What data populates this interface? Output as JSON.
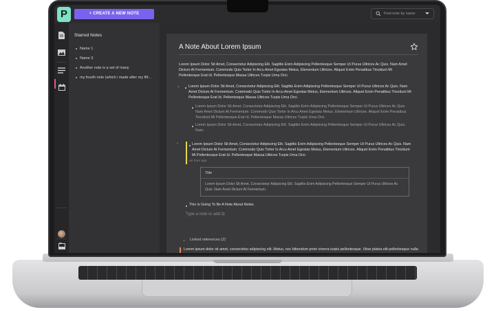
{
  "app": {
    "logo_letter": "P",
    "create_button": "+ CREATE A NEW NOTE",
    "search": {
      "placeholder": "Find note by name"
    }
  },
  "rail": {
    "icons": [
      "document-icon",
      "image-icon",
      "notes-list-icon",
      "calendar-icon"
    ],
    "active_index": 2,
    "help_label": "?"
  },
  "sidebar": {
    "title": "Starred Notes",
    "items": [
      {
        "label": "Name 1"
      },
      {
        "label": "Name 3"
      },
      {
        "label": "Another note is a set of many"
      },
      {
        "label": "my fourth note (which i made after my fift..."
      }
    ]
  },
  "note": {
    "title": "A Note About Lorem Ipsum",
    "intro": "Lorem Ipsum Dolor Sit Amet, Consectetur Adipiscing Elit. Sagittis Enim Adipiscing Pellentesque Semper Ut Purus Ultrices Ac Quis. Nam Amet Dictum At Fermentum. Commodo Quis Tortor In Arcu Amet Egestas Metus, Elementum Ultrices. Aliquet Enim Penatibus Tincidunt Mi Pellentesque Erat Id. Pellentesque Massa Ultrices Turpis Urna Orci.",
    "block1": "Lorem Ipsum Dolor Sit Amet, Consectetur Adipiscing Elit. Sagittis Enim Adipiscing Pellentesque Semper Ut Purus Ultrices Ac Quis. Nam Amet Dictum At Fermentum. Commodo Quis Tortor In Arcu Amet Egestas Metus, Elementum Ultrices. Aliquet Enim Penatibus Tincidunt Mi Pellentesque Erat Id. Pellentesque Massa Ultrices Turpis Urna Orci.",
    "sub1": "Lorem Ipsum Dolor Sit Amet, Consectetur Adipiscing Elit. Sagittis Enim Adipiscing Pellentesque Semper Ut Purus Ultrices Ac Quis. Nam Amet Dictum At Fermentum. Commodo Quis Tortor In Arcu Amet Egestas Metus, Elementum Ultrices. Aliquet Enim Penatibus Tincidunt Mi Pellentesque Erat Id. Pellentesque Massa Ultrices Turpis Urna Orci.",
    "sub2": "Lorem Ipsum Dolor Sit Amet, Consectetur Adipiscing Elit. Sagittis Enim Adipiscing Pellentesque Semper Ut Purus Ultrices Ac Quis. Nam.",
    "block2": "Lorem Ipsum Dolor Sit Amet, Consectetur Adipiscing Elit. Sagittis Enim Adipiscing Pellentesque Semper Ut Purus Ultrices Ac Quis. Nam Amet Dictum At Fermentum. Commodo Quis Tortor In Arcu Amet Egestas Metus, Elementum Ultrices. Aliquet Enim Penatibus Tincidunt Mi Pellentesque Erat Id. Pellentesque Massa Ultrices Turpis Urna Orci.",
    "block2_time": "an hour ago",
    "embed": {
      "title": "Title",
      "body": "Lorem Ipsum Dolor Sit Amet, Consectetur Adipiscing Elit. Sagittis Enim Adipiscing Pellentesque Semper Ut Purus Ultrices Ac Quis. Nam Amet Dictum At Fermentum."
    },
    "block3": "This Is Going To Be A Note About Notes.",
    "add_hint": "Type a note or add",
    "linked_refs": "Linked references (2)",
    "linked_text": "Lorem ipsum dolor sit amet, consectetur adipiscing elit. Metus, nec bibendum proin viverra turpis pellentesque. Vitae platea elit pellentesque nulla semper porttitor facilisis sit auctor. Nisl neque et suspendisse ornare nulla turpis massa. Et montes, consectetur lacus bibendum. Nunc et eget nibh."
  },
  "colors": {
    "accent": "#7b62ee",
    "logo": "#7fe3c6",
    "active_marker": "#e8577b",
    "highlight_bar": "#e6d94a"
  }
}
